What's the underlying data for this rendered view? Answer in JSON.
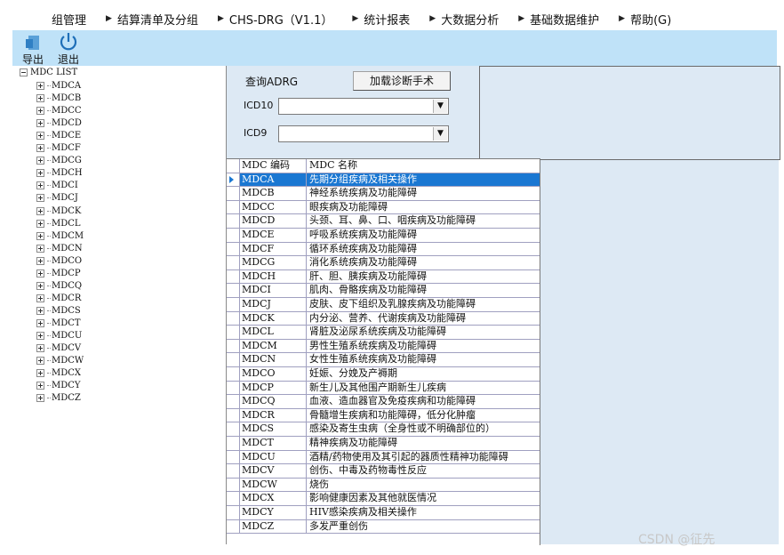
{
  "menu": [
    "病组管理",
    "结算清单及分组",
    "CHS-DRG（V1.1）",
    "统计报表",
    "大数据分析",
    "基础数据维护",
    "帮助(G)"
  ],
  "menu_partial_first": "组管理",
  "toolbar": {
    "export_label": "导出",
    "exit_label": "退出"
  },
  "tree": {
    "root_label": "MDC LIST",
    "nodes": [
      "MDCA",
      "MDCB",
      "MDCC",
      "MDCD",
      "MDCE",
      "MDCF",
      "MDCG",
      "MDCH",
      "MDCI",
      "MDCJ",
      "MDCK",
      "MDCL",
      "MDCM",
      "MDCN",
      "MDCO",
      "MDCP",
      "MDCQ",
      "MDCR",
      "MDCS",
      "MDCT",
      "MDCU",
      "MDCV",
      "MDCW",
      "MDCX",
      "MDCY",
      "MDCZ"
    ]
  },
  "query": {
    "title": "查询ADRG",
    "load_button": "加载诊断手术",
    "icd10_label": "ICD10",
    "icd10_value": "",
    "icd9_label": "ICD9",
    "icd9_value": ""
  },
  "grid": {
    "col_code": "MDC 编码",
    "col_name": "MDC 名称",
    "selected_index": 0,
    "rows": [
      {
        "code": "MDCA",
        "name": "先期分组疾病及相关操作"
      },
      {
        "code": "MDCB",
        "name": "神经系统疾病及功能障碍"
      },
      {
        "code": "MDCC",
        "name": "眼疾病及功能障碍"
      },
      {
        "code": "MDCD",
        "name": "头颈、耳、鼻、口、咽疾病及功能障碍"
      },
      {
        "code": "MDCE",
        "name": "呼吸系统疾病及功能障碍"
      },
      {
        "code": "MDCF",
        "name": "循环系统疾病及功能障碍"
      },
      {
        "code": "MDCG",
        "name": "消化系统疾病及功能障碍"
      },
      {
        "code": "MDCH",
        "name": "肝、胆、胰疾病及功能障碍"
      },
      {
        "code": "MDCI",
        "name": "肌肉、骨骼疾病及功能障碍"
      },
      {
        "code": "MDCJ",
        "name": "皮肤、皮下组织及乳腺疾病及功能障碍"
      },
      {
        "code": "MDCK",
        "name": "内分泌、营养、代谢疾病及功能障碍"
      },
      {
        "code": "MDCL",
        "name": "肾脏及泌尿系统疾病及功能障碍"
      },
      {
        "code": "MDCM",
        "name": "男性生殖系统疾病及功能障碍"
      },
      {
        "code": "MDCN",
        "name": "女性生殖系统疾病及功能障碍"
      },
      {
        "code": "MDCO",
        "name": "妊娠、分娩及产褥期"
      },
      {
        "code": "MDCP",
        "name": "新生儿及其他围产期新生儿疾病"
      },
      {
        "code": "MDCQ",
        "name": "血液、造血器官及免疫疾病和功能障碍"
      },
      {
        "code": "MDCR",
        "name": "骨髓增生疾病和功能障碍，低分化肿瘤"
      },
      {
        "code": "MDCS",
        "name": "感染及寄生虫病（全身性或不明确部位的）"
      },
      {
        "code": "MDCT",
        "name": "精神疾病及功能障碍"
      },
      {
        "code": "MDCU",
        "name": "酒精/药物使用及其引起的器质性精神功能障碍"
      },
      {
        "code": "MDCV",
        "name": "创伤、中毒及药物毒性反应"
      },
      {
        "code": "MDCW",
        "name": "烧伤"
      },
      {
        "code": "MDCX",
        "name": "影响健康因素及其他就医情况"
      },
      {
        "code": "MDCY",
        "name": "HIV感染疾病及相关操作"
      },
      {
        "code": "MDCZ",
        "name": "多发严重创伤"
      }
    ]
  },
  "watermark": "CSDN @征先",
  "colors": {
    "toolbar_bg": "#bfe2f8",
    "panel_bg": "#dde9f4",
    "selection": "#1a77d2"
  }
}
